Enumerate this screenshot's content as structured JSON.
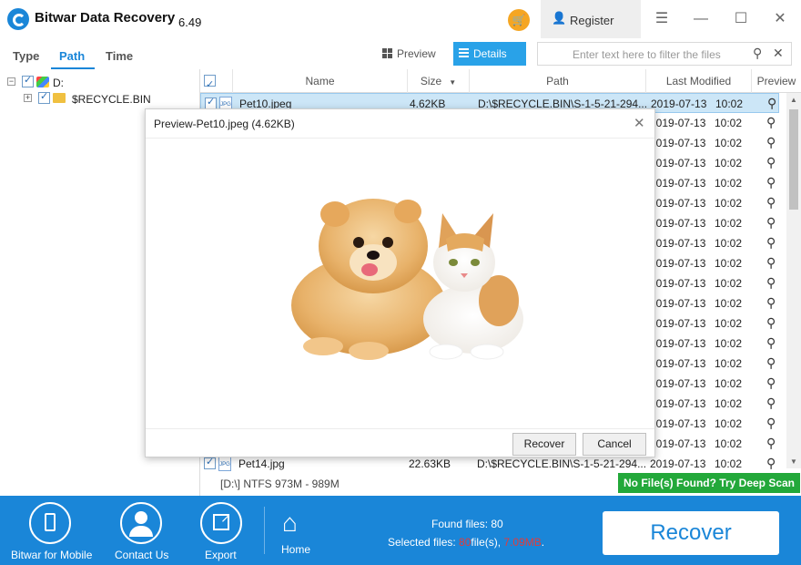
{
  "app": {
    "title": "Bitwar Data Recovery",
    "version": "6.49"
  },
  "titlebar": {
    "register_label": "Register",
    "cart_icon": "cart-icon",
    "accent": "#f5a623"
  },
  "tabs": [
    {
      "label": "Type",
      "active": false
    },
    {
      "label": "Path",
      "active": true
    },
    {
      "label": "Time",
      "active": false
    }
  ],
  "view": {
    "preview_label": "Preview",
    "details_label": "Details",
    "active": "Details",
    "accent": "#29a2e8"
  },
  "filter": {
    "placeholder": "Enter text here to filter the files"
  },
  "tree": [
    {
      "label": "D:",
      "checked": true
    },
    {
      "label": "$RECYCLE.BIN",
      "checked": true
    }
  ],
  "table": {
    "columns": [
      "Name",
      "Size",
      "Path",
      "Last Modified",
      "Preview"
    ],
    "sort_column": "Size",
    "rows": [
      {
        "name": "Pet10.jpeg",
        "size": "4.62KB",
        "path": "D:\\$RECYCLE.BIN\\S-1-5-21-294...",
        "date": "2019-07-13",
        "time": "10:02",
        "checked": true,
        "selected": true
      },
      {
        "name": "",
        "size": "",
        "path": "",
        "date": "2019-07-13",
        "time": "10:02"
      },
      {
        "name": "",
        "size": "",
        "path": "",
        "date": "2019-07-13",
        "time": "10:02"
      },
      {
        "name": "",
        "size": "",
        "path": "",
        "date": "2019-07-13",
        "time": "10:02"
      },
      {
        "name": "",
        "size": "",
        "path": "",
        "date": "2019-07-13",
        "time": "10:02"
      },
      {
        "name": "",
        "size": "",
        "path": "",
        "date": "2019-07-13",
        "time": "10:02"
      },
      {
        "name": "",
        "size": "",
        "path": "",
        "date": "2019-07-13",
        "time": "10:02"
      },
      {
        "name": "",
        "size": "",
        "path": "",
        "date": "2019-07-13",
        "time": "10:02"
      },
      {
        "name": "",
        "size": "",
        "path": "",
        "date": "2019-07-13",
        "time": "10:02"
      },
      {
        "name": "",
        "size": "",
        "path": "",
        "date": "2019-07-13",
        "time": "10:02"
      },
      {
        "name": "",
        "size": "",
        "path": "",
        "date": "2019-07-13",
        "time": "10:02"
      },
      {
        "name": "",
        "size": "",
        "path": "",
        "date": "2019-07-13",
        "time": "10:02"
      },
      {
        "name": "",
        "size": "",
        "path": "",
        "date": "2019-07-13",
        "time": "10:02"
      },
      {
        "name": "",
        "size": "",
        "path": "",
        "date": "2019-07-13",
        "time": "10:02"
      },
      {
        "name": "",
        "size": "",
        "path": "",
        "date": "2019-07-13",
        "time": "10:02"
      },
      {
        "name": "",
        "size": "",
        "path": "",
        "date": "2019-07-13",
        "time": "10:02"
      },
      {
        "name": "",
        "size": "",
        "path": "",
        "date": "2019-07-13",
        "time": "10:02"
      },
      {
        "name": "",
        "size": "",
        "path": "",
        "date": "2019-07-13",
        "time": "10:02"
      },
      {
        "name": "Pet14.jpg",
        "size": "22.63KB",
        "path": "D:\\$RECYCLE.BIN\\S-1-5-21-294...",
        "date": "2019-07-13",
        "time": "10:02",
        "checked": true
      }
    ]
  },
  "status": {
    "drive_info": "[D:\\] NTFS 973M - 989M",
    "deep_scan": "No File(s) Found? Try Deep Scan",
    "deep_scan_color": "#23a83a"
  },
  "preview_dialog": {
    "title": "Preview-Pet10.jpeg (4.62KB)",
    "recover_label": "Recover",
    "cancel_label": "Cancel"
  },
  "bottom": {
    "items": [
      {
        "label": "Bitwar for Mobile",
        "icon": "phone-icon"
      },
      {
        "label": "Contact Us",
        "icon": "user-icon"
      },
      {
        "label": "Export",
        "icon": "export-icon"
      },
      {
        "label": "Home",
        "icon": "home-icon"
      }
    ],
    "found_prefix": "Found files: ",
    "found_count": "80",
    "selected_prefix": "Selected files: ",
    "selected_count": "80",
    "selected_mid": "file(s), ",
    "selected_size": "7.09MB",
    "selected_suffix": ".",
    "recover_label": "Recover",
    "bar_color": "#1a86d8"
  }
}
